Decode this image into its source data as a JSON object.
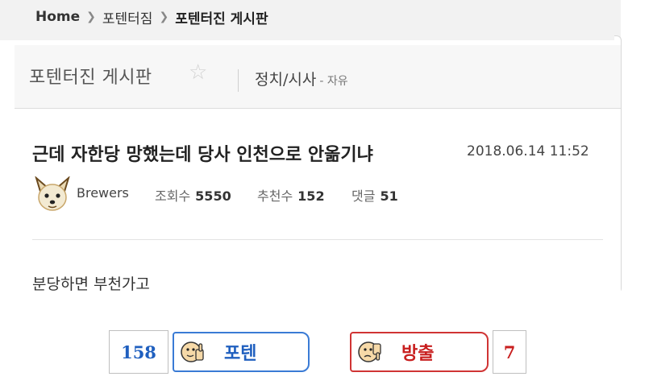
{
  "breadcrumb": {
    "home": "Home",
    "level1": "포텐터짐",
    "level2": "포텐터진 게시판"
  },
  "board": {
    "title": "포텐터진 게시판",
    "star_icon": "star-outline-icon",
    "category": "정치/시사",
    "subcategory": "- 자유"
  },
  "post": {
    "title": "근데 자한당 망했는데 당사 인천으로 안옮기냐",
    "date": "2018.06.14 11:52",
    "author": "Brewers",
    "views_label": "조회수",
    "views": "5550",
    "recommend_label": "추천수",
    "recommend": "152",
    "comments_label": "댓글",
    "comments": "51",
    "body": "분당하면 부천가고"
  },
  "votes": {
    "up_count": "158",
    "up_label": "포텐",
    "up_icon": "thumbs-up-face-icon",
    "up_color": "#1f5fbf",
    "down_count": "7",
    "down_label": "방출",
    "down_icon": "thumbs-down-face-icon",
    "down_color": "#c81e1e"
  }
}
